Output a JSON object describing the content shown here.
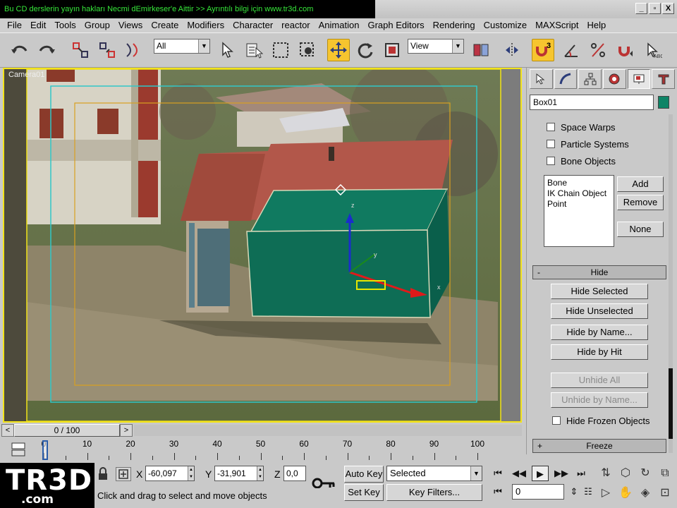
{
  "title_bar": {
    "banner": "Bu CD derslerin yayın hakları Necmi dEmirkeser'e Aittir >> Ayrıntılı bilgi için  www.tr3d.com",
    "buttons": [
      "_",
      "▫",
      "X"
    ]
  },
  "menu": [
    "File",
    "Edit",
    "Tools",
    "Group",
    "Views",
    "Create",
    "Modifiers",
    "Character",
    "reactor",
    "Animation",
    "Graph Editors",
    "Rendering",
    "Customize",
    "MAXScript",
    "Help"
  ],
  "toolbar": {
    "selection_filter": "All",
    "coord_system": "View",
    "icons": [
      "undo-icon",
      "redo-icon",
      "select-and-link-icon",
      "unlink-icon",
      "bind-spacewarp-icon",
      "select-object-icon",
      "select-by-name-icon",
      "rectangular-region-icon",
      "window-crossing-icon",
      "select-and-move-icon",
      "select-and-rotate-icon",
      "select-and-scale-icon",
      "pivot-center-icon",
      "mirror-icon",
      "snap-3d-icon",
      "angle-snap-icon",
      "percent-snap-icon",
      "spinner-snap-icon"
    ],
    "snap_number": "3"
  },
  "viewport": {
    "label": "Camera01",
    "object_color": "#0e7a5f",
    "border_color": "#f2e31a"
  },
  "command_panel": {
    "object_name": "Box01",
    "object_color": "#0e8466",
    "checkboxes": [
      "Space Warps",
      "Particle Systems",
      "Bone Objects"
    ],
    "list_items": [
      "Bone",
      "IK Chain Object",
      "Point"
    ],
    "list_buttons": {
      "add": "Add",
      "remove": "Remove",
      "none": "None"
    },
    "hide_rollout": {
      "title": "Hide",
      "sign": "-",
      "buttons": [
        "Hide Selected",
        "Hide Unselected",
        "Hide by Name...",
        "Hide by Hit"
      ],
      "disabled_buttons": [
        "Unhide All",
        "Unhide by Name..."
      ],
      "checkbox": "Hide Frozen Objects"
    },
    "freeze_rollout": {
      "title": "Freeze",
      "sign": "+"
    }
  },
  "time_slider": {
    "label": "0 / 100",
    "left_arrow": "<",
    "right_arrow": ">"
  },
  "track_bar": {
    "ticks": [
      0,
      10,
      20,
      30,
      40,
      50,
      60,
      70,
      80,
      90,
      100
    ]
  },
  "status": {
    "logo_main": "TR3D",
    "logo_sub": ".com",
    "x_label": "X",
    "y_label": "Y",
    "z_label": "Z",
    "x_value": "-60,097",
    "y_value": "-31,901",
    "z_value": "0,0",
    "prompt": "Click and drag to select and move objects",
    "auto_key": "Auto Key",
    "set_key": "Set Key",
    "selected_dropdown": "Selected",
    "key_filters": "Key Filters...",
    "current_frame": "0"
  }
}
